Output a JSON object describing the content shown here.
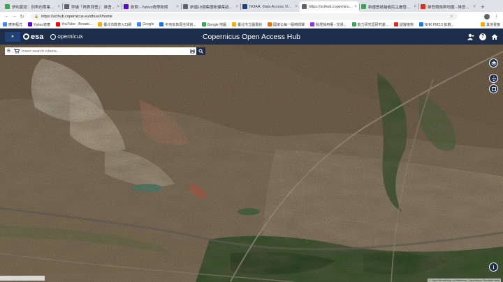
{
  "browser": {
    "tabs": [
      {
        "title": "伊利夏提：別再向專業處人...",
        "color": "#34a853",
        "active": false
      },
      {
        "title": "評議「再教育營」：維吾爾...",
        "color": "#5f6368",
        "active": false
      },
      {
        "title": "新聞 - Yahoo奇摩新聞",
        "color": "#6001d2",
        "active": false
      },
      {
        "title": "新疆18個集團新建集結設施...",
        "color": "#5f6368",
        "active": false
      },
      {
        "title": "NOAA: Data Access Viewer",
        "color": "#1a4480",
        "active": false
      },
      {
        "title": "https://scihub.copernicus.e...",
        "color": "#5f6368",
        "active": true
      },
      {
        "title": "新疆營被捕者民主義發現場...",
        "color": "#34a853",
        "active": false
      },
      {
        "title": "維吾爾族群地圖 - 維吾爾人...",
        "color": "#d93025",
        "active": false
      }
    ],
    "new_tab_glyph": "+",
    "url": "https://scihub.copernicus.eu/dhus/#/home",
    "bookmarks": [
      {
        "label": "應用程式",
        "color": "#4285f4"
      },
      {
        "label": "Yahoo奇摩",
        "color": "#6001d2"
      },
      {
        "label": "YouTube - Broadc...",
        "color": "#ff0000"
      },
      {
        "label": "臺北市教育入口網",
        "color": "#f9ab00"
      },
      {
        "label": "Google",
        "color": "#4285f4"
      },
      {
        "label": "中央氣象局全球資...",
        "color": "#1a73e8"
      },
      {
        "label": "Google 地圖",
        "color": "#34a853"
      },
      {
        "label": "臺北市立圖書館",
        "color": "#f9ab00"
      },
      {
        "label": "國家公每一級時間聲",
        "color": "#e8710a"
      },
      {
        "label": "點燈採用權 - 交通...",
        "color": "#9334e6"
      },
      {
        "label": "能力研究壹研究委...",
        "color": "#34a853"
      },
      {
        "label": "認識植物",
        "color": "#d93025"
      },
      {
        "label": "NHK PM2.5 拡散...",
        "color": "#1a73e8"
      }
    ],
    "bookmarks_other": "其他書籤"
  },
  "header": {
    "esa": "esa",
    "copernicus": "opernicus",
    "title": "Copernicus Open Access Hub",
    "bg_color": "#1d2e4b"
  },
  "search": {
    "placeholder": "Insert search criteria..."
  },
  "map": {
    "attribution": "© OpenStreetMap contributors, Copernicus Sentinel data"
  }
}
